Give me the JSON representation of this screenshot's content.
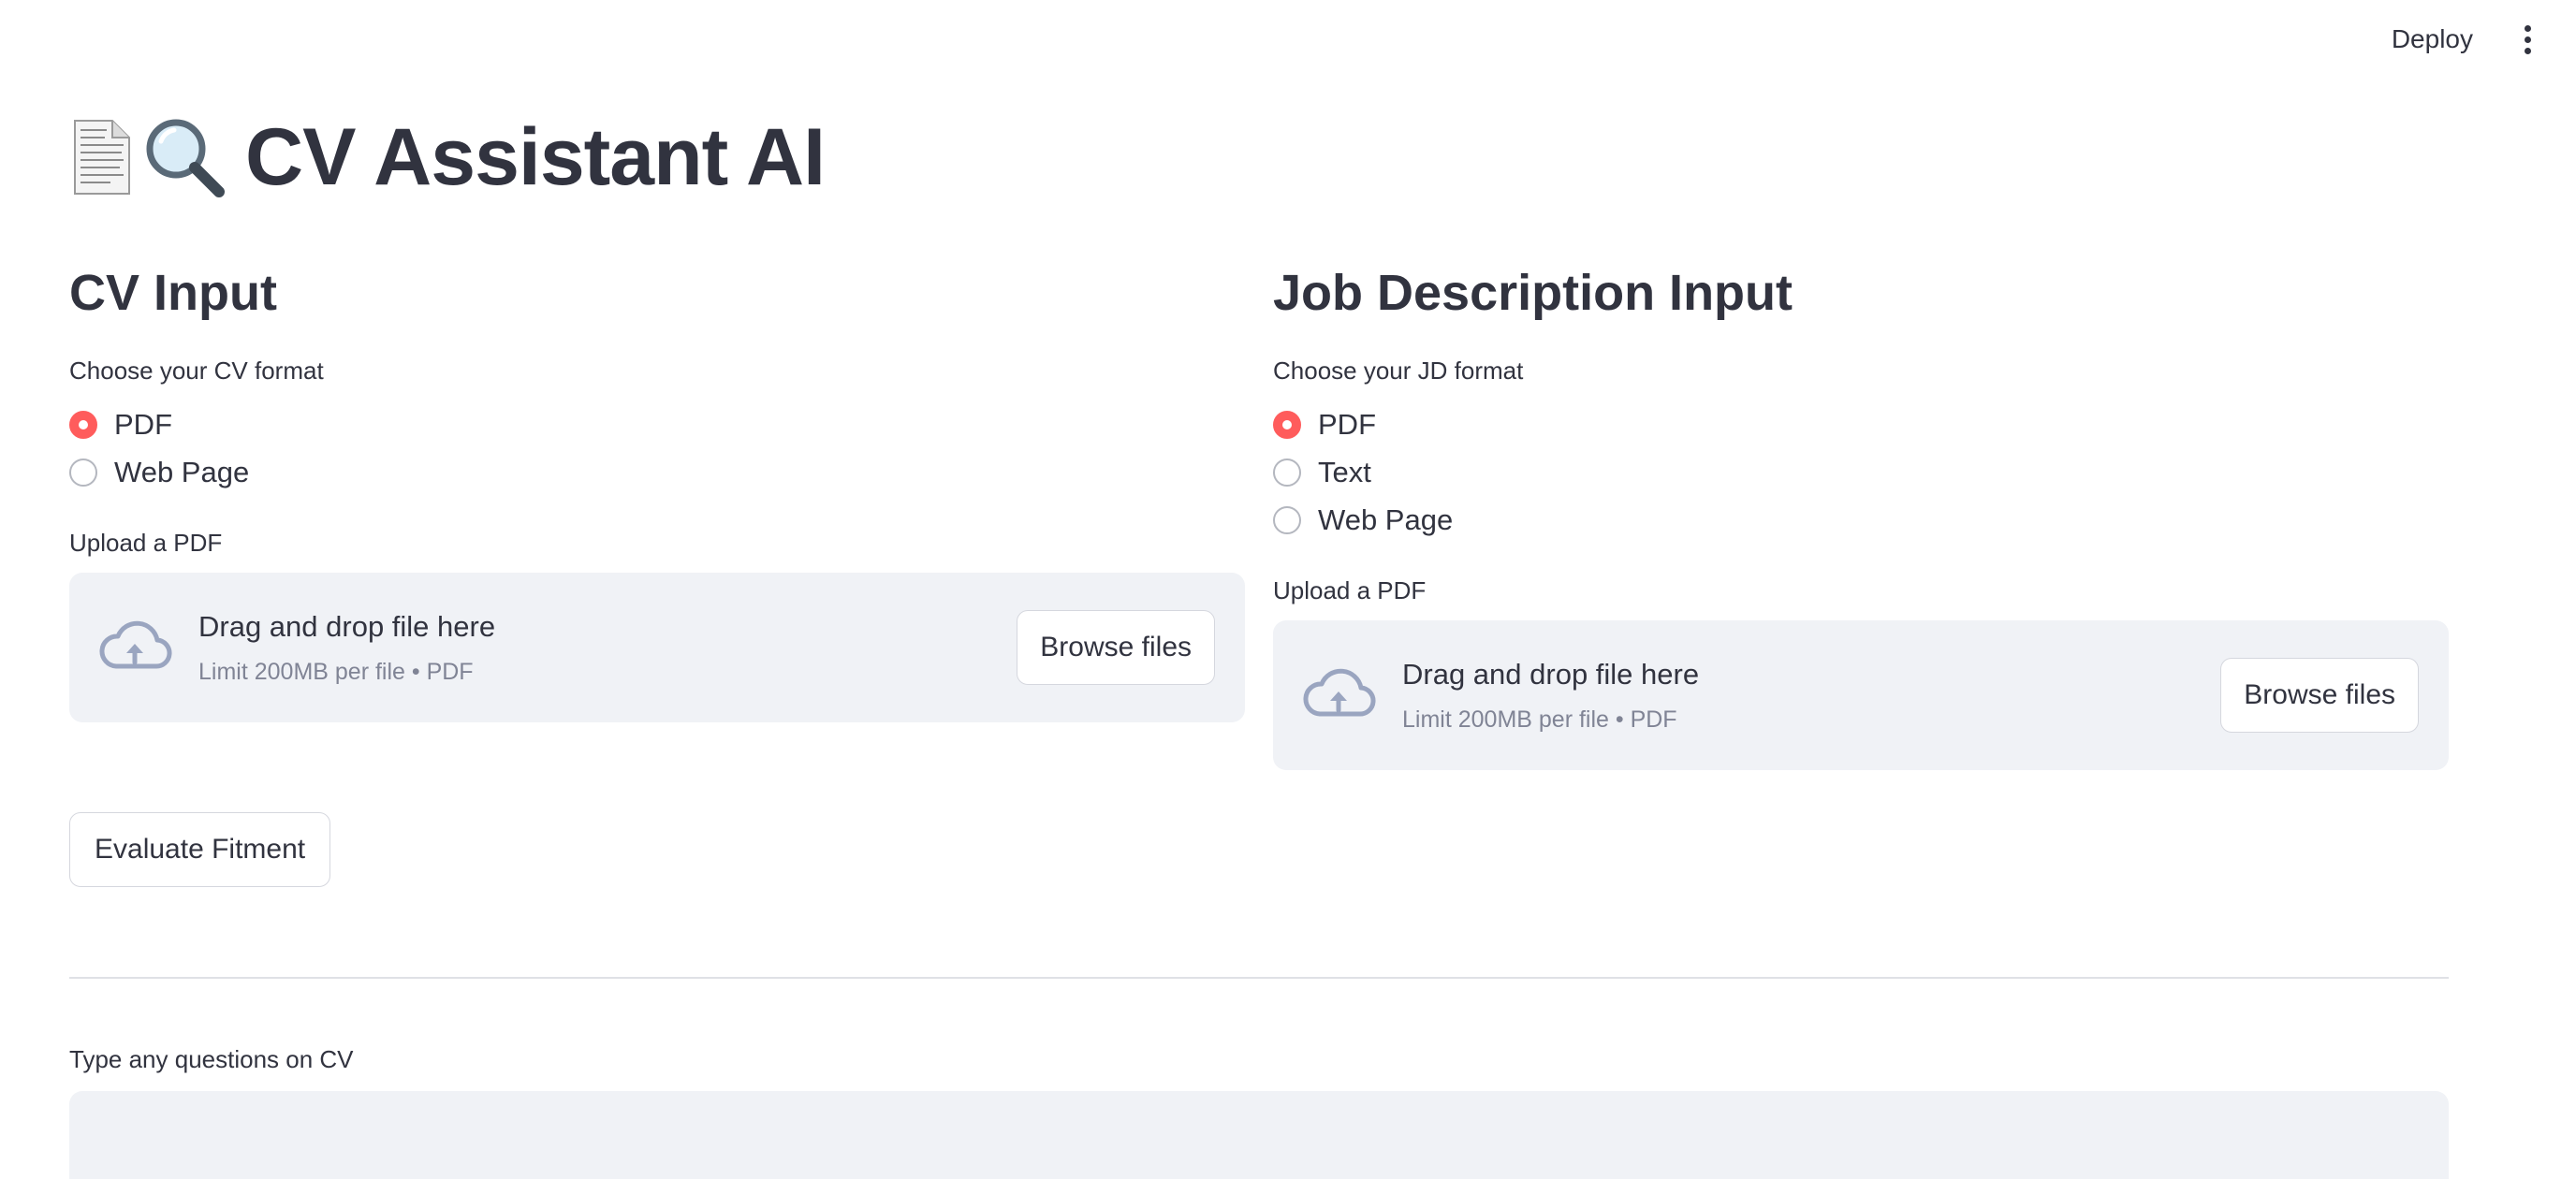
{
  "toolbar": {
    "deploy_label": "Deploy",
    "menu_icon": "kebab-menu-icon"
  },
  "header": {
    "title": "CV Assistant AI",
    "icons": [
      "document-icon",
      "magnifying-glass-icon"
    ]
  },
  "cv_section": {
    "heading": "CV Input",
    "format_label": "Choose your CV format",
    "options": [
      "PDF",
      "Web Page"
    ],
    "selected": "PDF",
    "upload_label": "Upload a PDF",
    "dropzone": {
      "title": "Drag and drop file here",
      "subtitle": "Limit 200MB per file • PDF",
      "button": "Browse files",
      "icon": "cloud-upload-icon"
    }
  },
  "jd_section": {
    "heading": "Job Description Input",
    "format_label": "Choose your JD format",
    "options": [
      "PDF",
      "Text",
      "Web Page"
    ],
    "selected": "PDF",
    "upload_label": "Upload a PDF",
    "dropzone": {
      "title": "Drag and drop file here",
      "subtitle": "Limit 200MB per file • PDF",
      "button": "Browse files",
      "icon": "cloud-upload-icon"
    }
  },
  "actions": {
    "evaluate_label": "Evaluate Fitment"
  },
  "questions": {
    "label": "Type any questions on CV",
    "value": ""
  },
  "colors": {
    "accent": "#ff4b4b",
    "text": "#31333f",
    "muted": "#808495",
    "surface": "#f0f2f6"
  }
}
